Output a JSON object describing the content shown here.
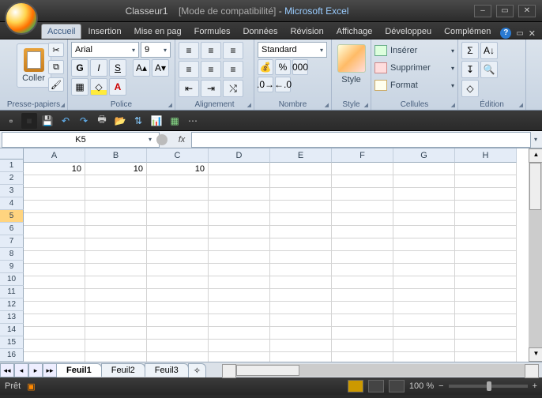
{
  "title": {
    "doc": "Classeur1",
    "mode": "[Mode de compatibilité]",
    "sep": " - ",
    "app": "Microsoft Excel"
  },
  "tabs": [
    "Accueil",
    "Insertion",
    "Mise en pag",
    "Formules",
    "Données",
    "Révision",
    "Affichage",
    "Développeu",
    "Complémen"
  ],
  "active_tab": 0,
  "ribbon": {
    "clipboard": {
      "label": "Presse-papiers",
      "paste": "Coller"
    },
    "font": {
      "label": "Police",
      "name": "Arial",
      "size": "9",
      "bold": "G",
      "italic": "I",
      "underline": "S"
    },
    "align": {
      "label": "Alignement"
    },
    "number": {
      "label": "Nombre",
      "format": "Standard"
    },
    "styles": {
      "label": "Style",
      "btn": "Style"
    },
    "cells": {
      "label": "Cellules",
      "insert": "Insérer",
      "delete": "Supprimer",
      "format": "Format"
    },
    "editing": {
      "label": "Édition"
    }
  },
  "namebox": "K5",
  "fx": "fx",
  "formula": "",
  "columns": [
    "A",
    "B",
    "C",
    "D",
    "E",
    "F",
    "G",
    "H"
  ],
  "rows": 16,
  "selected_row": 5,
  "cells": {
    "A1": "10",
    "B1": "10",
    "C1": "10"
  },
  "sheets": [
    "Feuil1",
    "Feuil2",
    "Feuil3"
  ],
  "active_sheet": 0,
  "status": {
    "ready": "Prêt",
    "zoom": "100 %"
  },
  "chart_data": {
    "type": "table",
    "columns": [
      "A",
      "B",
      "C",
      "D",
      "E",
      "F",
      "G",
      "H"
    ],
    "rows": [
      [
        10,
        10,
        10,
        null,
        null,
        null,
        null,
        null
      ]
    ]
  }
}
